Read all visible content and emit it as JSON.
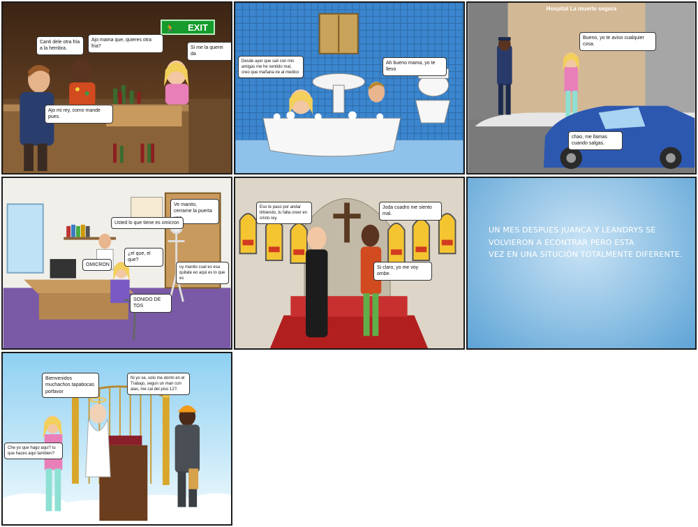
{
  "panel1": {
    "exit_sign": "EXIT",
    "bubbles": [
      "Canti dele otra fria a la hembra.",
      "Ajo mama que, quieres otra fria?",
      "Si me la querei da",
      "Ajo mi rey, como mande pues."
    ]
  },
  "panel2": {
    "bubbles": [
      "Desde ayer que sali con mis amigas me he sentido mal, creo que mañana ire al medico",
      "Ah bueno mama, yo te llevo"
    ]
  },
  "panel3": {
    "sign": "Hospital La muerte segura",
    "bubbles": [
      "Bueno, yo te aviso cualquier cosa.",
      "chao, me llamas cuando salgas."
    ]
  },
  "panel4": {
    "bubbles": [
      "Ve manito, cerrame la puerta vee.",
      "Usted lo que tiene es omicron",
      "OMICRON",
      "¿el que, el que?",
      "uy manito cual es esa quitate eo aqui es lo que es",
      "SONIDO DE TOS"
    ]
  },
  "panel5": {
    "bubbles": [
      "Eso te paso por andar tirbiendo, tu falta creer en cristo rey.",
      "Joda cuadro me siento mal.",
      "Si claro, yo me voy ombe."
    ]
  },
  "panel6": {
    "caption": "UN MES DESPUES  JUANCA Y  LEANDRYS SE\n  VOLVIERON A ECONTRAR PERO ESTA\nVEZ EN UNA SITUCIÓN TOTALMENTE DIFERENTE."
  },
  "panel7": {
    "bubbles": [
      "Bienvenidos muchachos tapabocas porfavor",
      "Ni yo se, solo me dormi en el Trabajo, segun un man con alas, me cai del piso 12?.",
      "Che yo que hago aqui? tu que haces aqui tambien?"
    ]
  }
}
